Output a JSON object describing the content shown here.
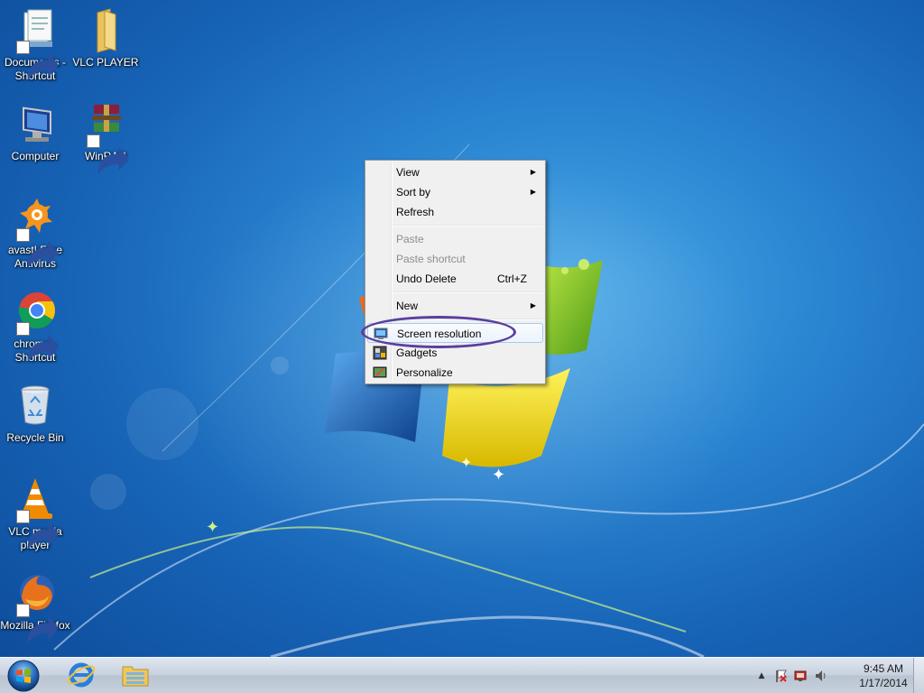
{
  "desktop_icons": [
    {
      "label": "Documents - Shortcut",
      "icon": "documents-icon",
      "shortcut": true
    },
    {
      "label": "VLC PLAYER",
      "icon": "folder-icon",
      "shortcut": false
    },
    {
      "label": "Computer",
      "icon": "computer-icon",
      "shortcut": false
    },
    {
      "label": "WinRAR",
      "icon": "winrar-icon",
      "shortcut": true
    },
    {
      "label": "avast! Free Antivirus",
      "icon": "avast-icon",
      "shortcut": true
    },
    {
      "label": "chrome - Shortcut",
      "icon": "chrome-icon",
      "shortcut": true
    },
    {
      "label": "Recycle Bin",
      "icon": "recycle-bin-icon",
      "shortcut": false
    },
    {
      "label": "VLC media player",
      "icon": "vlc-cone-icon",
      "shortcut": true
    },
    {
      "label": "Mozilla Firefox",
      "icon": "firefox-icon",
      "shortcut": true
    }
  ],
  "context_menu": {
    "view": "View",
    "sort_by": "Sort by",
    "refresh": "Refresh",
    "paste": "Paste",
    "paste_shortcut": "Paste shortcut",
    "undo_delete": "Undo Delete",
    "undo_delete_shortcut": "Ctrl+Z",
    "new": "New",
    "screen_resolution": "Screen resolution",
    "gadgets": "Gadgets",
    "personalize": "Personalize",
    "submenu_arrow": "▶",
    "highlighted_item": "Screen resolution",
    "highlight_color": "#5b3f9e"
  },
  "taskbar": {
    "start_icon": "windows-start-icon",
    "pinned": [
      "internet-explorer-icon",
      "windows-explorer-icon"
    ],
    "tray_icons": [
      "show-hidden-icons-arrow",
      "action-center-flag-icon",
      "network-icon",
      "volume-icon"
    ],
    "tray_arrow": "▲",
    "time": "9:45 AM",
    "date": "1/17/2014"
  },
  "colors": {
    "desktop_blue": "#1e72c4",
    "menu_background": "#f0f0f0",
    "taskbar": "#c8d2de"
  }
}
